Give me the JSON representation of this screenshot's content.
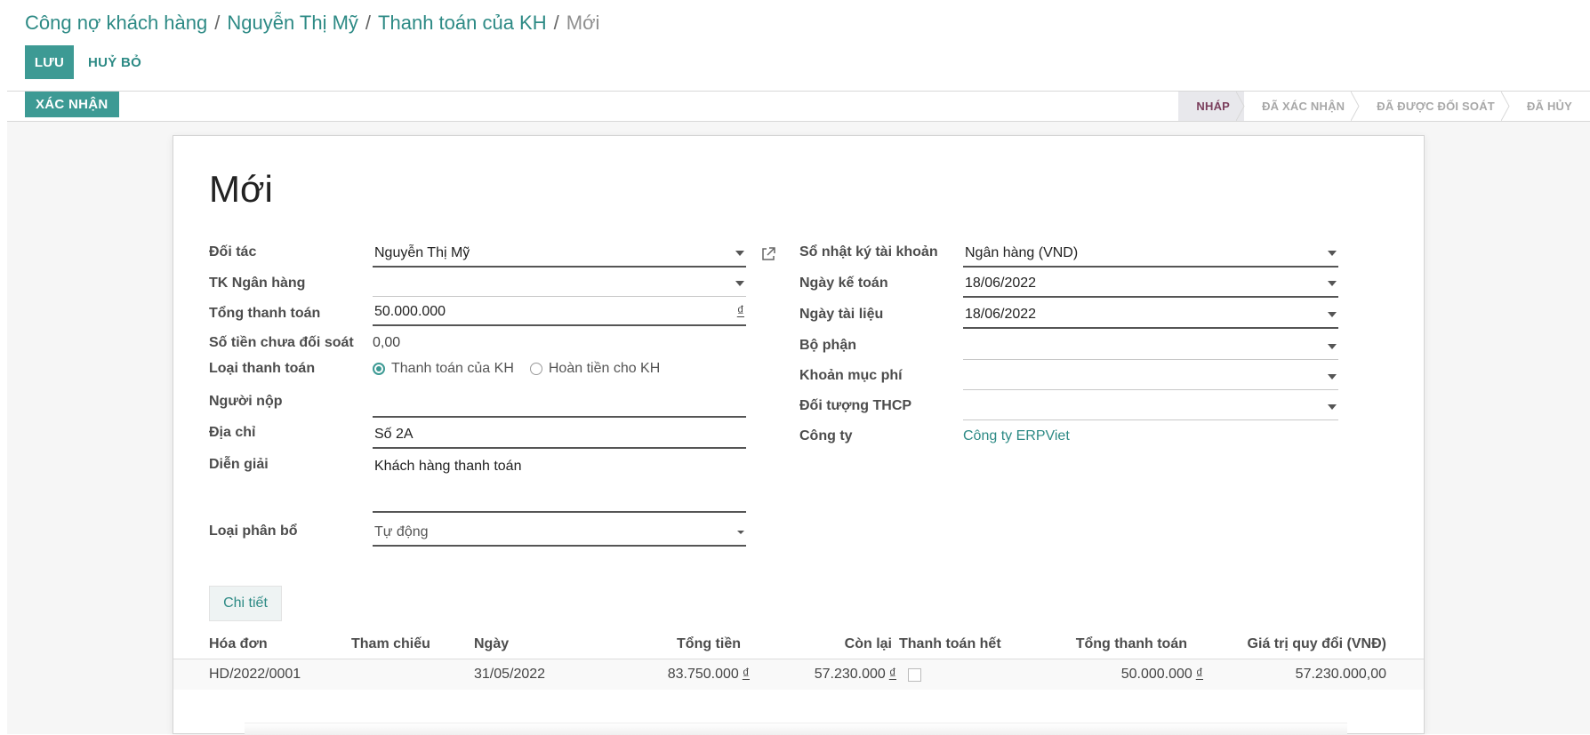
{
  "breadcrumb": {
    "items": [
      "Công nợ khách hàng",
      "Nguyễn Thị Mỹ",
      "Thanh toán của KH"
    ],
    "current": "Mới",
    "separator": "/"
  },
  "toolbar": {
    "save_label": "LƯU",
    "discard_label": "HUỶ BỎ"
  },
  "statusbar": {
    "confirm_label": "XÁC NHẬN",
    "stages": [
      "NHÁP",
      "ĐÃ XÁC NHẬN",
      "ĐÃ ĐƯỢC ĐỐI SOÁT",
      "ĐÃ HỦY"
    ],
    "active_stage": "NHÁP"
  },
  "form": {
    "title": "Mới",
    "left": {
      "partner_label": "Đối tác",
      "partner_value": "Nguyễn Thị Mỹ",
      "bank_label": "TK Ngân hàng",
      "bank_value": "",
      "amount_label": "Tổng thanh toán",
      "amount_value": "50.000.000",
      "currency": "₫",
      "unreconciled_label": "Số tiền chưa đối soát",
      "unreconciled_value": "0,00",
      "payment_type_label": "Loại thanh toán",
      "payment_type_options": [
        "Thanh toán của KH",
        "Hoàn tiền cho KH"
      ],
      "payment_type_selected": "Thanh toán của KH",
      "payer_label": "Người nộp",
      "payer_value": "",
      "address_label": "Địa chỉ",
      "address_value": "Số 2A",
      "memo_label": "Diễn giải",
      "memo_value": "Khách hàng thanh toán",
      "allocation_label": "Loại phân bổ",
      "allocation_value": "Tự động"
    },
    "right": {
      "journal_label": "Sổ nhật ký tài khoản",
      "journal_value": "Ngân hàng (VND)",
      "accounting_date_label": "Ngày kế toán",
      "accounting_date_value": "18/06/2022",
      "document_date_label": "Ngày tài liệu",
      "document_date_value": "18/06/2022",
      "department_label": "Bộ phận",
      "department_value": "",
      "expense_item_label": "Khoản mục phí",
      "expense_item_value": "",
      "cost_object_label": "Đối tượng THCP",
      "cost_object_value": "",
      "company_label": "Công ty",
      "company_value": "Công ty ERPViet"
    }
  },
  "details": {
    "tab_label": "Chi tiết",
    "columns": [
      "Hóa đơn",
      "Tham chiếu",
      "Ngày",
      "Tổng tiền",
      "Còn lại",
      "Thanh toán hết",
      "Tổng thanh toán",
      "Giá trị quy đổi (VNĐ)"
    ],
    "rows": [
      {
        "invoice": "HD/2022/0001",
        "reference": "",
        "date": "31/05/2022",
        "total": "83.750.000",
        "remaining": "57.230.000",
        "paid_full": false,
        "payment": "50.000.000",
        "converted": "57.230.000,00",
        "currency": "₫"
      }
    ]
  },
  "colors": {
    "accent": "#3d9a94",
    "link": "#2d8a85",
    "active_stage_text": "#7a3e5c"
  },
  "icons": {
    "external_link": "external-link-icon",
    "dropdown": "chevron-down-icon"
  }
}
